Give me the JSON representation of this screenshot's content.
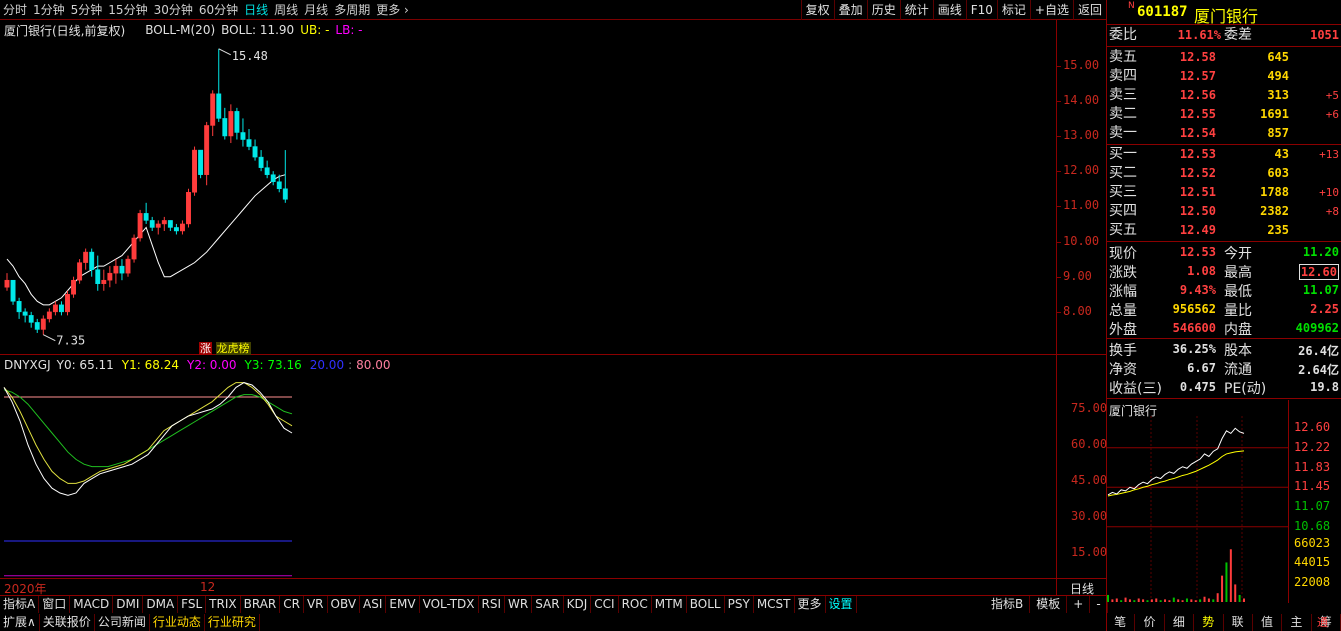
{
  "toolbar": {
    "periods": [
      "分时",
      "1分钟",
      "5分钟",
      "15分钟",
      "30分钟",
      "60分钟",
      "日线",
      "周线",
      "月线",
      "多周期",
      "更多 ›"
    ],
    "active_period": "日线",
    "tools": [
      "复权",
      "叠加",
      "历史",
      "统计",
      "画线",
      "F10",
      "标记",
      "+自选",
      "返回"
    ]
  },
  "main_chart": {
    "title": "厦门银行(日线,前复权)",
    "boll_label": "BOLL-M(20)",
    "boll_value": "BOLL: 11.90",
    "ub_label": "UB: -",
    "lb_label": "LB: -",
    "high_marker": "15.48",
    "low_marker": "7.35",
    "zhang_tag": "涨",
    "bang_tag": "龙虎榜",
    "y_ticks": [
      "15.00",
      "14.00",
      "13.00",
      "12.00",
      "11.00",
      "10.00",
      "9.00",
      "8.00"
    ],
    "y_range": [
      7.2,
      15.9
    ],
    "candles": [
      [
        8.7,
        9.1,
        8.6,
        8.9
      ],
      [
        8.9,
        8.9,
        8.2,
        8.3
      ],
      [
        8.3,
        8.4,
        7.8,
        8.0
      ],
      [
        8.0,
        8.1,
        7.7,
        7.9
      ],
      [
        7.9,
        8.0,
        7.55,
        7.7
      ],
      [
        7.7,
        7.8,
        7.4,
        7.5
      ],
      [
        7.5,
        7.9,
        7.35,
        7.8
      ],
      [
        7.8,
        8.1,
        7.7,
        8.0
      ],
      [
        8.0,
        8.3,
        7.9,
        8.2
      ],
      [
        8.2,
        8.3,
        7.9,
        8.0
      ],
      [
        8.0,
        8.6,
        7.9,
        8.5
      ],
      [
        8.5,
        9.0,
        8.4,
        8.9
      ],
      [
        8.9,
        9.5,
        8.8,
        9.4
      ],
      [
        9.4,
        9.8,
        9.2,
        9.7
      ],
      [
        9.7,
        9.8,
        9.0,
        9.2
      ],
      [
        9.2,
        9.6,
        8.6,
        8.8
      ],
      [
        8.8,
        9.2,
        8.6,
        8.9
      ],
      [
        8.9,
        9.3,
        8.7,
        9.1
      ],
      [
        9.1,
        9.5,
        8.8,
        9.3
      ],
      [
        9.3,
        9.5,
        8.9,
        9.1
      ],
      [
        9.1,
        9.6,
        9.0,
        9.5
      ],
      [
        9.5,
        10.2,
        9.4,
        10.1
      ],
      [
        10.1,
        10.9,
        10.0,
        10.8
      ],
      [
        10.8,
        11.1,
        10.5,
        10.6
      ],
      [
        10.6,
        10.7,
        10.3,
        10.4
      ],
      [
        10.4,
        10.6,
        10.2,
        10.5
      ],
      [
        10.5,
        10.7,
        10.3,
        10.6
      ],
      [
        10.6,
        10.6,
        10.3,
        10.4
      ],
      [
        10.4,
        10.5,
        10.2,
        10.3
      ],
      [
        10.3,
        10.6,
        10.2,
        10.5
      ],
      [
        10.5,
        11.5,
        10.4,
        11.4
      ],
      [
        11.4,
        12.7,
        11.3,
        12.6
      ],
      [
        12.6,
        12.6,
        11.8,
        11.9
      ],
      [
        11.9,
        13.4,
        11.6,
        13.3
      ],
      [
        13.3,
        14.3,
        13.0,
        14.2
      ],
      [
        14.2,
        15.48,
        13.4,
        13.5
      ],
      [
        13.5,
        13.8,
        12.9,
        13.0
      ],
      [
        13.0,
        13.9,
        12.8,
        13.7
      ],
      [
        13.7,
        13.8,
        12.9,
        13.1
      ],
      [
        13.1,
        13.5,
        12.7,
        12.9
      ],
      [
        12.9,
        13.2,
        12.6,
        12.7
      ],
      [
        12.7,
        12.9,
        12.3,
        12.4
      ],
      [
        12.4,
        12.6,
        12.0,
        12.1
      ],
      [
        12.1,
        12.3,
        11.8,
        11.9
      ],
      [
        11.9,
        12.0,
        11.6,
        11.7
      ],
      [
        11.7,
        11.9,
        11.4,
        11.5
      ],
      [
        11.5,
        12.6,
        11.1,
        11.2
      ]
    ],
    "ma_line": [
      9.5,
      9.3,
      9.0,
      8.8,
      8.5,
      8.3,
      8.2,
      8.2,
      8.3,
      8.4,
      8.6,
      8.8,
      9.0,
      9.1,
      9.2,
      9.3,
      9.3,
      9.4,
      9.5,
      9.6,
      9.8,
      10.0,
      10.2,
      10.4,
      9.9,
      9.4,
      9.0,
      9.0,
      9.1,
      9.2,
      9.3,
      9.4,
      9.55,
      9.7,
      9.9,
      10.1,
      10.3,
      10.5,
      10.7,
      10.9,
      11.1,
      11.3,
      11.45,
      11.6,
      11.75,
      11.85,
      11.9
    ]
  },
  "sub_chart": {
    "name": "DNYXGJ",
    "y0": "Y0: 65.11",
    "y1": "Y1: 68.24",
    "y2": "Y2: 0.00",
    "y3": "Y3: 73.16",
    "l20": "20.00",
    "l80": "80.00",
    "y_ticks": [
      "75.00",
      "60.00",
      "45.00",
      "30.00",
      "15.00"
    ],
    "y_range": [
      5,
      95
    ],
    "y0_line": [
      84,
      78,
      70,
      60,
      52,
      46,
      42,
      40,
      39,
      40,
      44,
      46,
      48,
      49,
      50,
      51,
      52,
      54,
      56,
      60,
      64,
      68,
      70,
      72,
      73,
      74,
      75,
      77,
      80,
      84,
      86,
      85,
      82,
      78,
      72,
      67,
      65
    ],
    "y1_line": [
      84,
      80,
      74,
      67,
      60,
      54,
      49,
      46,
      44,
      44,
      45,
      47,
      49,
      50,
      51,
      52,
      54,
      56,
      58,
      62,
      66,
      68,
      70,
      72,
      74,
      76,
      78,
      81,
      84,
      86,
      86,
      84,
      81,
      77,
      72,
      70,
      68
    ],
    "y3_line": [
      83,
      82,
      80,
      77,
      73,
      69,
      65,
      61,
      57,
      54,
      52,
      51,
      51,
      51,
      52,
      53,
      54,
      56,
      58,
      60,
      62,
      64,
      66,
      68,
      70,
      72,
      74,
      76,
      78,
      80,
      81,
      81,
      80,
      78,
      76,
      74,
      73
    ]
  },
  "time_axis": {
    "year": "2020年",
    "month": "12",
    "period": "日线"
  },
  "quote": {
    "code_prefix": "N",
    "code": "601187",
    "name": "厦门银行",
    "weibi_label": "委比",
    "weibi": "11.61%",
    "weicha_label": "委差",
    "weicha": "1051",
    "asks": [
      {
        "label": "卖五",
        "price": "12.58",
        "vol": "645",
        "chg": ""
      },
      {
        "label": "卖四",
        "price": "12.57",
        "vol": "494",
        "chg": ""
      },
      {
        "label": "卖三",
        "price": "12.56",
        "vol": "313",
        "chg": "+5"
      },
      {
        "label": "卖二",
        "price": "12.55",
        "vol": "1691",
        "chg": "+6"
      },
      {
        "label": "卖一",
        "price": "12.54",
        "vol": "857",
        "chg": ""
      }
    ],
    "bids": [
      {
        "label": "买一",
        "price": "12.53",
        "vol": "43",
        "chg": "+13"
      },
      {
        "label": "买二",
        "price": "12.52",
        "vol": "603",
        "chg": ""
      },
      {
        "label": "买三",
        "price": "12.51",
        "vol": "1788",
        "chg": "+10"
      },
      {
        "label": "买四",
        "price": "12.50",
        "vol": "2382",
        "chg": "+8"
      },
      {
        "label": "买五",
        "price": "12.49",
        "vol": "235",
        "chg": ""
      }
    ],
    "stats": [
      {
        "l1": "现价",
        "v1": "12.53",
        "c1": "#ff4040",
        "l2": "今开",
        "v2": "11.20",
        "c2": "#00e000"
      },
      {
        "l1": "涨跌",
        "v1": "1.08",
        "c1": "#ff4040",
        "l2": "最高",
        "v2": "12.60",
        "c2": "#ff4040"
      },
      {
        "l1": "涨幅",
        "v1": "9.43%",
        "c1": "#ff4040",
        "l2": "最低",
        "v2": "11.07",
        "c2": "#00e000"
      },
      {
        "l1": "总量",
        "v1": "956562",
        "c1": "#ffd700",
        "l2": "量比",
        "v2": "2.25",
        "c2": "#ff4040"
      },
      {
        "l1": "外盘",
        "v1": "546600",
        "c1": "#ff4040",
        "l2": "内盘",
        "v2": "409962",
        "c2": "#00e000"
      }
    ],
    "info": [
      {
        "l1": "换手",
        "v1": "36.25%",
        "l2": "股本",
        "v2": "26.4亿"
      },
      {
        "l1": "净资",
        "v1": "6.67",
        "l2": "流通",
        "v2": "2.64亿"
      },
      {
        "l1": "收益(三)",
        "v1": "0.475",
        "l2": "PE(动)",
        "v2": "19.8"
      }
    ]
  },
  "mini_chart": {
    "title": "厦门银行",
    "price_ticks": [
      "12.60",
      "12.22",
      "11.83",
      "11.45",
      "11.07",
      "10.68"
    ],
    "vol_ticks": [
      "66023",
      "44015",
      "22008"
    ],
    "price_range": [
      10.5,
      12.8
    ],
    "price_line": [
      11.3,
      11.35,
      11.32,
      11.4,
      11.38,
      11.45,
      11.42,
      11.5,
      11.55,
      11.52,
      11.6,
      11.65,
      11.62,
      11.7,
      11.75,
      11.72,
      11.8,
      11.85,
      11.82,
      11.9,
      11.95,
      12.0,
      12.1,
      12.05,
      12.15,
      12.2,
      12.4,
      12.55,
      12.5,
      12.6,
      12.53,
      12.5
    ],
    "avg_line": [
      11.28,
      11.3,
      11.31,
      11.33,
      11.35,
      11.37,
      11.4,
      11.42,
      11.45,
      11.47,
      11.5,
      11.52,
      11.55,
      11.57,
      11.6,
      11.62,
      11.65,
      11.68,
      11.7,
      11.73,
      11.76,
      11.8,
      11.84,
      11.88,
      11.93,
      11.98,
      12.05,
      12.1,
      12.12,
      12.14,
      12.15,
      12.16
    ],
    "vols": [
      8,
      3,
      4,
      2,
      5,
      3,
      2,
      4,
      3,
      2,
      3,
      4,
      2,
      3,
      2,
      5,
      3,
      2,
      4,
      3,
      2,
      3,
      6,
      4,
      3,
      10,
      30,
      45,
      60,
      20,
      8,
      4
    ]
  },
  "indicator_tabs": [
    "指标A",
    "窗口",
    "MACD",
    "DMI",
    "DMA",
    "FSL",
    "TRIX",
    "BRAR",
    "CR",
    "VR",
    "OBV",
    "ASI",
    "EMV",
    "VOL-TDX",
    "RSI",
    "WR",
    "SAR",
    "KDJ",
    "CCI",
    "ROC",
    "MTM",
    "BOLL",
    "PSY",
    "MCST",
    "更多",
    "设置"
  ],
  "indicator_right": [
    "指标B",
    "模板",
    "+",
    "-"
  ],
  "ext_tabs": [
    "扩展∧",
    "关联报价",
    "公司新闻",
    "行业动态",
    "行业研究"
  ],
  "mini_tabs": [
    "笔",
    "价",
    "细",
    "势",
    "联",
    "值",
    "主",
    "筹"
  ],
  "mini_tab_active": "势",
  "mini_corner": "通"
}
